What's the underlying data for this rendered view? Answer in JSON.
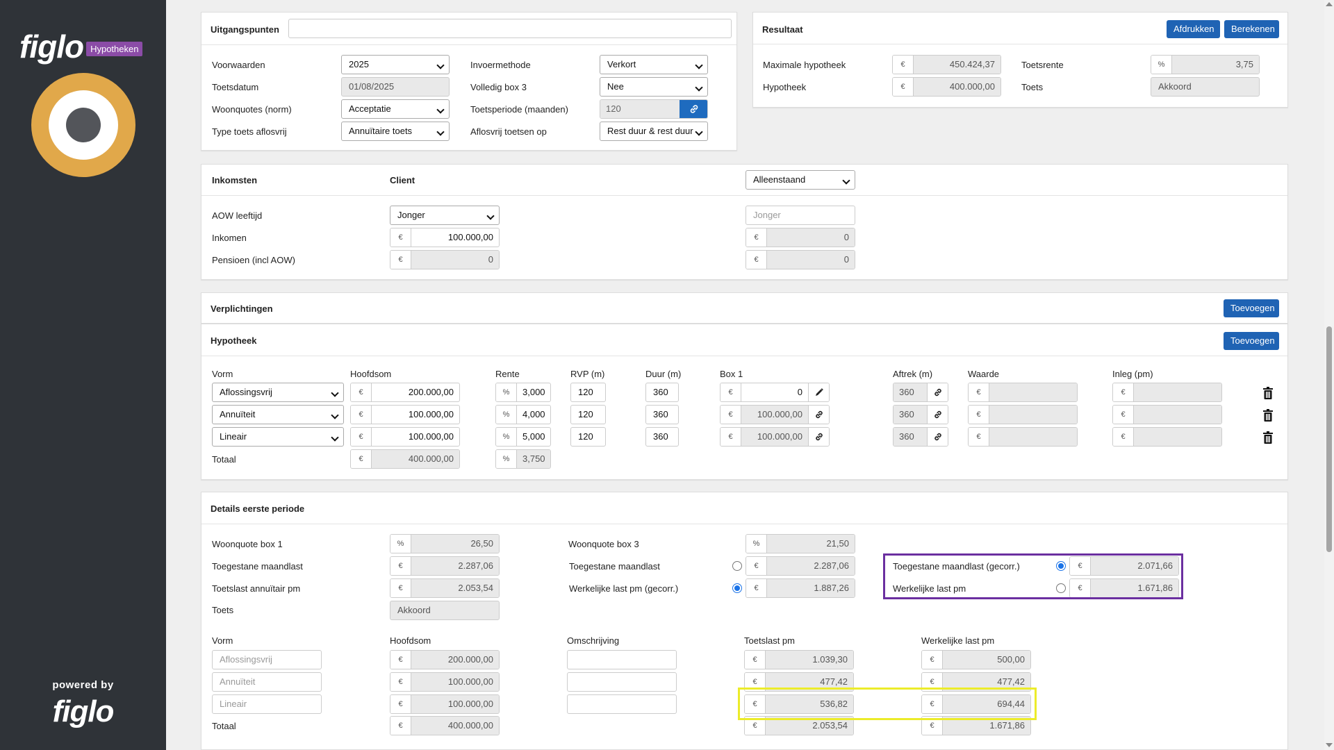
{
  "sidebar": {
    "brand": "figlo",
    "badge": "Hypotheken",
    "powered_by": "powered by",
    "footer_brand": "figlo"
  },
  "uitgangspunten": {
    "title": "Uitgangspunten",
    "title_input": "",
    "voorwaarden_label": "Voorwaarden",
    "voorwaarden_value": "2025",
    "toetsdatum_label": "Toetsdatum",
    "toetsdatum_value": "01/08/2025",
    "woonquotes_label": "Woonquotes (norm)",
    "woonquotes_value": "Acceptatie",
    "type_toets_label": "Type toets aflosvrij",
    "type_toets_value": "Annuïtaire toets",
    "invoermethode_label": "Invoermethode",
    "invoermethode_value": "Verkort",
    "volledig_box3_label": "Volledig box 3",
    "volledig_box3_value": "Nee",
    "toetsperiode_label": "Toetsperiode (maanden)",
    "toetsperiode_value": "120",
    "aflosvrij_label": "Aflosvrij toetsen op",
    "aflosvrij_value": "Rest duur & rest duur"
  },
  "resultaat": {
    "title": "Resultaat",
    "print_label": "Afdrukken",
    "calc_label": "Berekenen",
    "max_hyp_label": "Maximale hypotheek",
    "max_hyp_value": "450.424,37",
    "hypotheek_label": "Hypotheek",
    "hypotheek_value": "400.000,00",
    "toetsrente_label": "Toetsrente",
    "toetsrente_value": "3,75",
    "toets_label": "Toets",
    "toets_value": "Akkoord",
    "euro": "€",
    "pct": "%"
  },
  "inkomsten": {
    "title": "Inkomsten",
    "client_label": "Client",
    "partner_select": "Alleenstaand",
    "aow_label": "AOW leeftijd",
    "aow_value": "Jonger",
    "aow_partner_ph": "Jonger",
    "inkomen_label": "Inkomen",
    "inkomen_value": "100.000,00",
    "inkomen_partner": "0",
    "pensioen_label": "Pensioen (incl AOW)",
    "pensioen_value": "0",
    "pensioen_partner": "0"
  },
  "verplichtingen": {
    "title": "Verplichtingen",
    "add_label": "Toevoegen"
  },
  "hypotheek": {
    "title": "Hypotheek",
    "add_label": "Toevoegen",
    "headers": {
      "vorm": "Vorm",
      "hoofdsom": "Hoofdsom",
      "rente": "Rente",
      "rvp": "RVP (m)",
      "duur": "Duur (m)",
      "box1": "Box 1",
      "aftrek": "Aftrek (m)",
      "waarde": "Waarde",
      "inleg": "Inleg (pm)"
    },
    "rows": [
      {
        "vorm": "Aflossingsvrij",
        "hoofdsom": "200.000,00",
        "rente": "3,000",
        "rvp": "120",
        "duur": "360",
        "box1": "0",
        "aftrek": "360"
      },
      {
        "vorm": "Annuïteit",
        "hoofdsom": "100.000,00",
        "rente": "4,000",
        "rvp": "120",
        "duur": "360",
        "box1": "100.000,00",
        "aftrek": "360"
      },
      {
        "vorm": "Lineair",
        "hoofdsom": "100.000,00",
        "rente": "5,000",
        "rvp": "120",
        "duur": "360",
        "box1": "100.000,00",
        "aftrek": "360"
      }
    ],
    "totaal_label": "Totaal",
    "totaal_hoofdsom": "400.000,00",
    "totaal_rente": "3,750"
  },
  "details": {
    "title": "Details eerste periode",
    "wq1_label": "Woonquote box 1",
    "wq1_value": "26,50",
    "tm_label": "Toegestane maandlast",
    "tm_value": "2.287,06",
    "tl_label": "Toetslast annuïtair pm",
    "tl_value": "2.053,54",
    "toets_label": "Toets",
    "toets_value": "Akkoord",
    "wq3_label": "Woonquote box 3",
    "wq3_value": "21,50",
    "tm2_label": "Toegestane maandlast",
    "tm2_value": "2.287,06",
    "wl_gecorr_label": "Werkelijke last pm (gecorr.)",
    "wl_gecorr_value": "1.887,26",
    "tm_gecorr_label": "Toegestane maandlast (gecorr.)",
    "tm_gecorr_value": "2.071,66",
    "wl_label": "Werkelijke last pm",
    "wl_value": "1.671,86",
    "headers": {
      "vorm": "Vorm",
      "hoofdsom": "Hoofdsom",
      "omschrijving": "Omschrijving",
      "toetslast": "Toetslast pm",
      "werkelijk": "Werkelijke last pm"
    },
    "rows": [
      {
        "vorm": "Aflossingsvrij",
        "hoofdsom": "200.000,00",
        "toetslast": "1.039,30",
        "werkelijk": "500,00"
      },
      {
        "vorm": "Annuïteit",
        "hoofdsom": "100.000,00",
        "toetslast": "477,42",
        "werkelijk": "477,42"
      },
      {
        "vorm": "Lineair",
        "hoofdsom": "100.000,00",
        "toetslast": "536,82",
        "werkelijk": "694,44"
      }
    ],
    "totaal_label": "Totaal",
    "totaal_hoofdsom": "400.000,00",
    "totaal_toetslast": "2.053,54",
    "totaal_werkelijk": "1.671,86"
  },
  "colors": {
    "accent": "#1f63b4",
    "sidebar": "#2f3338",
    "logo_ring": "#e1a84a",
    "highlight_purple": "#6b2fa0",
    "highlight_yellow": "#ecec2a"
  }
}
